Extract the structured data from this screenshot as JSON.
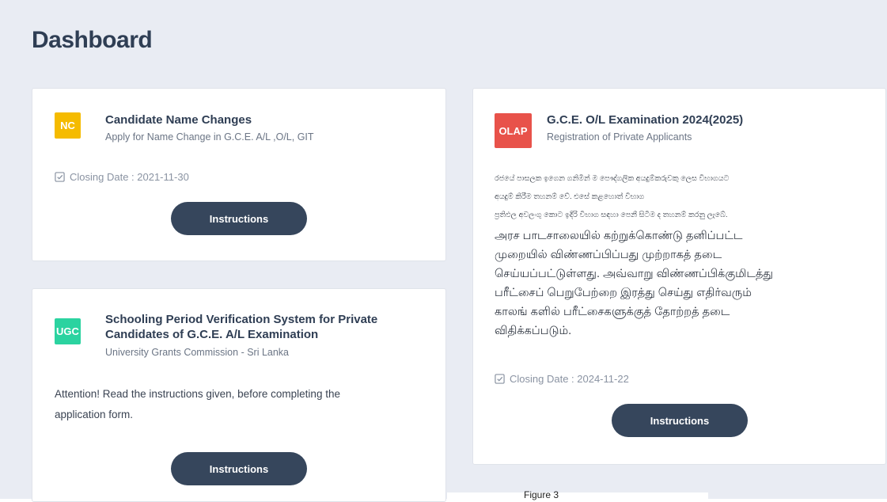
{
  "page": {
    "title": "Dashboard",
    "figure_caption": "Figure 3"
  },
  "cards": {
    "name_change": {
      "badge": "NC",
      "badge_color": "#f5bb00",
      "title": "Candidate Name Changes",
      "subtitle": "Apply for Name Change in G.C.E. A/L ,O/L, GIT",
      "closing_date": "Closing Date : 2021-11-30",
      "button_label": "Instructions"
    },
    "schooling": {
      "badge": "UGC",
      "badge_color": "#2bd3a0",
      "title_line1": "Schooling Period Verification System for Private",
      "title_line2": "Candidates of G.C.E. A/L Examination",
      "subtitle": "University Grants Commission - Sri Lanka",
      "body_line1": "Attention! Read the instructions given, before completing the",
      "body_line2": "application form.",
      "button_label": "Instructions"
    },
    "olap": {
      "badge": "OLAP",
      "badge_color": "#e8524a",
      "title": "G.C.E. O/L Examination 2024(2025)",
      "subtitle": "Registration of Private Applicants",
      "sinhala": [
        "රජයේ පාසලක ඉගෙන ගනිමින් ම පෞද්ගලික අයදුම්කරුවකු ලෙස විභාගයට",
        "අයදුම් කිරීම තහනම් වේ. එසේ කළහොත් විභාග",
        "ප්‍රතිඵල අවලංගු කොට ඉදිරි විභාග සඳහා පෙනී සිටීම ද තහනම් කරනු ලැබේ."
      ],
      "tamil": [
        "அரச பாடசாலையில் கற்றுக்கொண்டு தனிப்பட்ட",
        "முறையில் விண்ணப்பிப்பது முற்றாகத் தடை",
        "செய்யப்பட்டுள்ளது. அவ்வாறு விண்ணப்பிக்குமிடத்து",
        "பரீட்சைப் பெறுபேற்றை இரத்து செய்து எதிர்வரும்",
        "காலங் களில் பரீட்சைகளுக்குத் தோற்றத் தடை",
        "விதிக்கப்படும்."
      ],
      "closing_date": "Closing Date : 2024-11-22",
      "button_label": "Instructions"
    }
  },
  "icons": {
    "closing": "calendar-check-icon"
  }
}
